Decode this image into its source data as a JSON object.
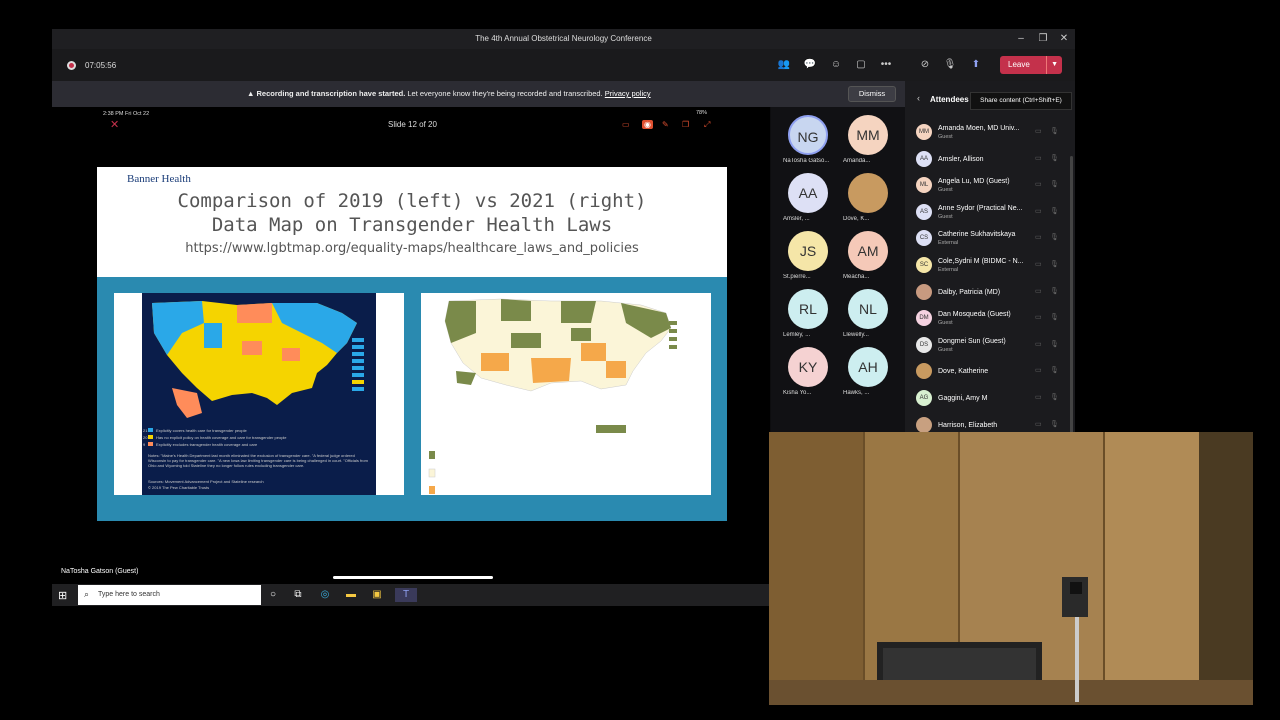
{
  "window": {
    "title": "The 4th Annual Obstetrical Neurology Conference"
  },
  "toolbar": {
    "timer": "07:05:56",
    "leave_label": "Leave"
  },
  "banner": {
    "bold": "Recording and transcription have started.",
    "text": " Let everyone know they're being recorded and transcribed.",
    "link": "Privacy policy",
    "dismiss_label": "Dismiss"
  },
  "share": {
    "tablet_status": "2:38 PM   Fri Oct 22",
    "slide_counter": "Slide 12 of 20",
    "presenter_name": "NaTosha Gatson (Guest)",
    "battery": "78%"
  },
  "slide": {
    "brand": "Banner Health",
    "title_line1": "Comparison of 2019 (left) vs 2021 (right)",
    "title_line2": "Data Map on Transgender Health Laws",
    "url": "https://www.lgbtmap.org/equality-maps/healthcare_laws_and_policies",
    "left_legend": [
      "Explicitly covers health care for transgender people",
      "Has no explicit policy on health coverage and care for transgender people",
      "Explicitly excludes transgender health coverage and care"
    ],
    "left_legend_counts": [
      "21",
      "20",
      "9"
    ],
    "left_notes": "Notes: \"Maine's Health Department last month eliminated the exclusion of transgender care. \"A federal judge ordered Wisconsin to pay for transgender care. \"A new Iowa law limiting transgender care is being challenged in court. \"Officials from Ohio and Wyoming told Stateline they no longer follow rules excluding transgender care.",
    "left_source": "Sources: Movement Advancement Project and Stateline research",
    "left_copyright": "© 2019 The Pew Charitable Trusts"
  },
  "taskbar": {
    "search_placeholder": "Type here to search"
  },
  "gallery": [
    {
      "initials": "NG",
      "name": "NaTosha Gatso...",
      "color": "#c8d6f0"
    },
    {
      "initials": "MM",
      "name": "Amanda...",
      "color": "#f5d4c0"
    },
    {
      "initials": "AA",
      "name": "Amsler, ...",
      "color": "#dde0f5"
    },
    {
      "initials": "",
      "name": "Dove, K...",
      "color": "#c89a60"
    },
    {
      "initials": "JS",
      "name": "St.pierre...",
      "color": "#f5e6a8"
    },
    {
      "initials": "AM",
      "name": "Meacha...",
      "color": "#f5c9b8"
    },
    {
      "initials": "RL",
      "name": "Lemley, ...",
      "color": "#cdeef0"
    },
    {
      "initials": "NL",
      "name": "Llewelly...",
      "color": "#cdeef0"
    },
    {
      "initials": "KY",
      "name": "Kisha Yo...",
      "color": "#f5d2d2"
    },
    {
      "initials": "AH",
      "name": "Hawks, ...",
      "color": "#cdeef0"
    }
  ],
  "panel": {
    "title": "Attendees",
    "tooltip": "Share content (Ctrl+Shift+E)",
    "attendees": [
      {
        "initials": "MM",
        "name": "Amanda Moen, MD Univ...",
        "sub": "Guest",
        "color": "#f5d4c0"
      },
      {
        "initials": "AA",
        "name": "Amsler, Allison",
        "sub": "",
        "color": "#dde0f5"
      },
      {
        "initials": "ML",
        "name": "Angela Lu, MD (Guest)",
        "sub": "Guest",
        "color": "#f5d4c0"
      },
      {
        "initials": "AS",
        "name": "Anne Sydor (Practical Ne...",
        "sub": "Guest",
        "color": "#dde0f5"
      },
      {
        "initials": "CS",
        "name": "Catherine Sukhavitskaya",
        "sub": "External",
        "color": "#dde0f5"
      },
      {
        "initials": "SC",
        "name": "Cole,Sydni M (BIDMC - N...",
        "sub": "External",
        "color": "#f5e6a8"
      },
      {
        "initials": "",
        "name": "Dalby, Patricia (MD)",
        "sub": "",
        "color": "#c89a80"
      },
      {
        "initials": "DM",
        "name": "Dan Mosqueda (Guest)",
        "sub": "Guest",
        "color": "#f5d2e0"
      },
      {
        "initials": "DS",
        "name": "Dongmei Sun (Guest)",
        "sub": "Guest",
        "color": "#e8e8e8"
      },
      {
        "initials": "",
        "name": "Dove, Katherine",
        "sub": "",
        "color": "#c89a60"
      },
      {
        "initials": "AG",
        "name": "Gaggini, Amy M",
        "sub": "",
        "color": "#d8f0d0"
      },
      {
        "initials": "",
        "name": "Harrison, Elizabeth",
        "sub": "",
        "color": "#c8a080"
      }
    ]
  }
}
